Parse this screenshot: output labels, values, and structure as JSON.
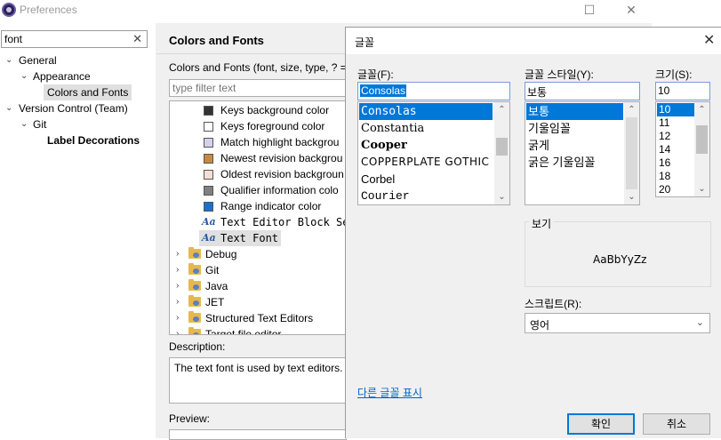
{
  "preferences": {
    "title": "Preferences",
    "filter_value": "font",
    "tree": [
      {
        "label": "General"
      },
      {
        "label": "Appearance"
      },
      {
        "label": "Colors and Fonts"
      },
      {
        "label": "Version Control (Team)"
      },
      {
        "label": "Git"
      },
      {
        "label": "Label Decorations"
      }
    ],
    "page_title": "Colors and Fonts",
    "page_desc": "Colors and Fonts (font, size, type, ? =",
    "type_filter_placeholder": "type filter text",
    "color_font_items": [
      {
        "label": "Keys background color",
        "color": "#333333"
      },
      {
        "label": "Keys foreground color",
        "color": "#ffffff"
      },
      {
        "label": "Match highlight backgrou",
        "color": "#d6cfee"
      },
      {
        "label": "Newest revision backgrou",
        "color": "#c88a40"
      },
      {
        "label": "Oldest revision backgroun",
        "color": "#f3ddd6"
      },
      {
        "label": "Qualifier information colo",
        "color": "#808080"
      },
      {
        "label": "Range indicator color",
        "color": "#1a6fd0"
      }
    ],
    "font_items": [
      {
        "label": "Text Editor Block Se",
        "icon": "Aa"
      },
      {
        "label": "Text Font",
        "icon": "Aa"
      }
    ],
    "categories": [
      "Debug",
      "Git",
      "Java",
      "JET",
      "Structured Text Editors",
      "Target file editor"
    ],
    "description_label": "Description:",
    "description_text": "The text font is used by text editors.",
    "preview_label": "Preview:"
  },
  "font_dialog": {
    "title": "글꼴",
    "font_label": "글꼴(F):",
    "font_value": "Consolas",
    "fonts": [
      "Consolas",
      "Constantia",
      "Cooper",
      "COPPERPLATE GOTHIC",
      "Corbel",
      "Courier"
    ],
    "style_label": "글꼴 스타일(Y):",
    "style_value": "보통",
    "styles": [
      "보통",
      "기울임꼴",
      "굵게",
      "굵은 기울임꼴"
    ],
    "size_label": "크기(S):",
    "size_value": "10",
    "sizes": [
      "10",
      "11",
      "12",
      "14",
      "16",
      "18",
      "20"
    ],
    "sample_label": "보기",
    "sample_text": "AaBbYyZz",
    "script_label": "스크립트(R):",
    "script_value": "영어",
    "more_fonts": "다른 글꼴 표시",
    "ok_label": "확인",
    "cancel_label": "취소"
  }
}
